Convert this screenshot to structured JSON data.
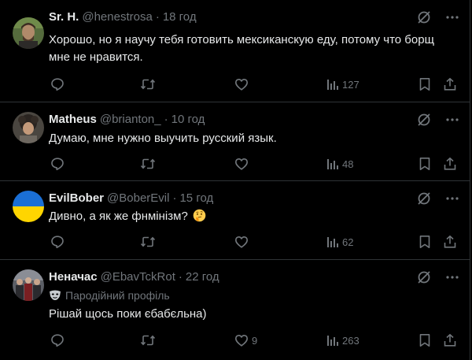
{
  "tweets": [
    {
      "name": "Sr. H.",
      "handle": "@henestrosa",
      "dot": "·",
      "time": "18 год",
      "text": "Хорошо, но я научу тебя готовить мексиканскую еду, потому что борщ мне не нравится.",
      "likes": "",
      "views": "127",
      "avatar": "portrait-green-bg"
    },
    {
      "name": "Matheus",
      "handle": "@brianton_",
      "dot": "·",
      "time": "10 год",
      "text": "Думаю, мне нужно выучить русский язык.",
      "likes": "",
      "views": "48",
      "avatar": "portrait-curly-hair"
    },
    {
      "name": "EvilBober",
      "handle": "@BoberEvil",
      "dot": "·",
      "time": "15 год",
      "text": "Дивно, а як же фнмінізм?",
      "likes": "",
      "views": "62",
      "avatar": "ukraine-flag",
      "emoji": "thinking-face"
    },
    {
      "name": "Неначас",
      "handle": "@EbavTckRot",
      "dot": "·",
      "time": "22 год",
      "parody_label": "Пародійний профіль",
      "text": "Рішай щось поки єбабєльна)",
      "likes": "9",
      "views": "263",
      "avatar": "group-photo"
    }
  ],
  "colors": {
    "background": "#000000",
    "text": "#e7e9ea",
    "muted": "#71767b",
    "divider": "#2f3336",
    "flag_blue": "#1a6fd6",
    "flag_yellow": "#ffd500"
  },
  "icons": [
    "grok-icon",
    "more-icon",
    "reply-icon",
    "retweet-icon",
    "like-icon",
    "views-icon",
    "bookmark-icon",
    "share-icon",
    "parody-mask-icon"
  ]
}
